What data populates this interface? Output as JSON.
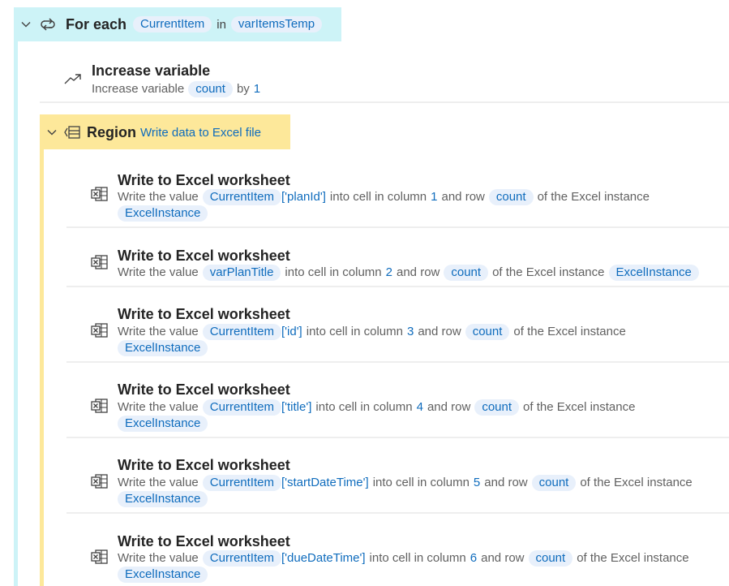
{
  "foreach": {
    "keyword": "For each",
    "item_var": "CurrentItem",
    "in_label": "in",
    "list_var": "varItemsTemp"
  },
  "increase": {
    "title": "Increase variable",
    "prefix": "Increase variable",
    "var": "count",
    "by_label": "by",
    "amount": "1"
  },
  "region": {
    "keyword": "Region",
    "name": "Write data to Excel file"
  },
  "steps": [
    {
      "title": "Write to Excel worksheet",
      "p1": "Write the value",
      "value_var": "CurrentItem",
      "value_suffix": "['planId']",
      "p2": "into cell in column",
      "column": "1",
      "p3": "and row",
      "row_var": "count",
      "p4": "of the Excel instance",
      "instance": "ExcelInstance"
    },
    {
      "title": "Write to Excel worksheet",
      "p1": "Write the value",
      "value_var": "varPlanTitle",
      "value_suffix": "",
      "p2": "into cell in column",
      "column": "2",
      "p3": "and row",
      "row_var": "count",
      "p4": "of the Excel instance",
      "instance": "ExcelInstance"
    },
    {
      "title": "Write to Excel worksheet",
      "p1": "Write the value",
      "value_var": "CurrentItem",
      "value_suffix": "['id']",
      "p2": "into cell in column",
      "column": "3",
      "p3": "and row",
      "row_var": "count",
      "p4": "of the Excel instance",
      "instance": "ExcelInstance"
    },
    {
      "title": "Write to Excel worksheet",
      "p1": "Write the value",
      "value_var": "CurrentItem",
      "value_suffix": "['title']",
      "p2": "into cell in column",
      "column": "4",
      "p3": "and row",
      "row_var": "count",
      "p4": "of the Excel instance",
      "instance": "ExcelInstance"
    },
    {
      "title": "Write to Excel worksheet",
      "p1": "Write the value",
      "value_var": "CurrentItem",
      "value_suffix": "['startDateTime']",
      "p2": "into cell in column",
      "column": "5",
      "p3": "and row",
      "row_var": "count",
      "p4": "of the Excel instance",
      "instance": "ExcelInstance"
    },
    {
      "title": "Write to Excel worksheet",
      "p1": "Write the value",
      "value_var": "CurrentItem",
      "value_suffix": "['dueDateTime']",
      "p2": "into cell in column",
      "column": "6",
      "p3": "and row",
      "row_var": "count",
      "p4": "of the Excel instance",
      "instance": "ExcelInstance"
    }
  ],
  "icons": {
    "foreach_collapse": "chevron-down-icon",
    "foreach": "loop-icon",
    "increase": "trend-up-icon",
    "region_collapse": "chevron-down-icon",
    "region": "region-icon",
    "excel": "excel-sheet-icon"
  },
  "colors": {
    "foreach_bg": "#cdf3f7",
    "region_bg": "#fde89a",
    "token": "#0f6cbd",
    "pill_bg": "#e8f0fb"
  }
}
